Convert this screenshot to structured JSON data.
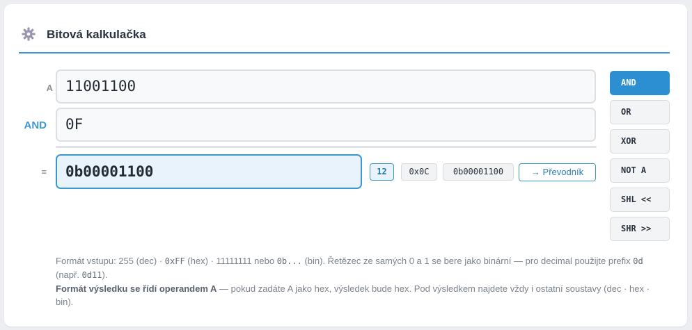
{
  "header": {
    "title": "Bitová kalkulačka",
    "icon": "gear-icon"
  },
  "inputs": {
    "a_label": "A",
    "a_value": "11001100",
    "op_label": "AND",
    "b_value": "0F",
    "eq_label": "=",
    "result_value": "0b00001100"
  },
  "result_badges": {
    "dec": "12",
    "hex": "0x0C",
    "bin": "0b00001100"
  },
  "converter_button": "→ Převodník",
  "operations": [
    {
      "label": "AND",
      "active": true
    },
    {
      "label": "OR",
      "active": false
    },
    {
      "label": "XOR",
      "active": false
    },
    {
      "label": "NOT A",
      "active": false
    },
    {
      "label": "SHL <<",
      "active": false
    },
    {
      "label": "SHR >>",
      "active": false
    }
  ],
  "help": {
    "p1_a": "Formát vstupu: 255 (dec) · ",
    "p1_hex": "0xFF",
    "p1_b": " (hex) · 11111111 nebo ",
    "p1_bin": "0b...",
    "p1_c": " (bin). Řetězec ze samých 0 a 1 se bere jako binární — pro decimal použijte prefix ",
    "p1_prefix": "0d",
    "p1_d": " (např. ",
    "p1_example": "0d11",
    "p1_e": ").",
    "p2_strong": "Formát výsledku se řídí operandem A",
    "p2_rest": " — pokud zadáte A jako hex, výsledek bude hex. Pod výsledkem najdete vždy i ostatní soustavy (dec · hex · bin)."
  },
  "colors": {
    "accent": "#3b97cf",
    "active_button": "#2b8fd2",
    "result_bg": "#e8f3fb"
  }
}
